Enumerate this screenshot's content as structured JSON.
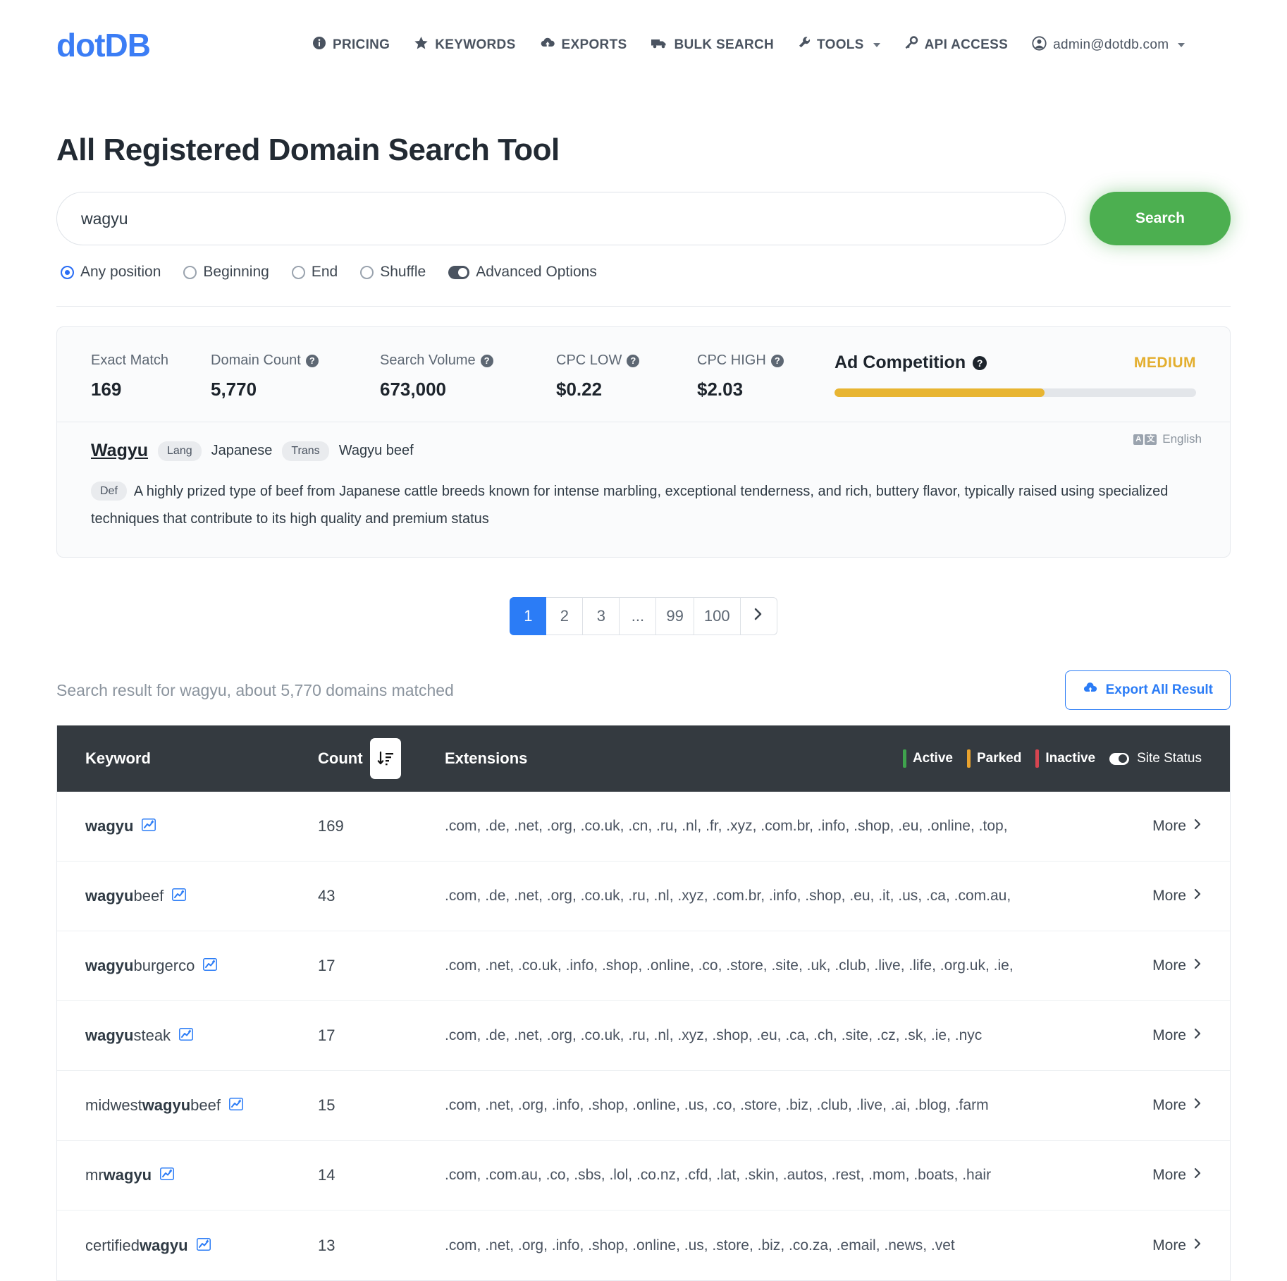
{
  "nav": {
    "brand": "dotDB",
    "links": [
      {
        "label": "PRICING",
        "icon": "info-icon"
      },
      {
        "label": "KEYWORDS",
        "icon": "star-icon"
      },
      {
        "label": "EXPORTS",
        "icon": "download-cloud-icon"
      },
      {
        "label": "BULK SEARCH",
        "icon": "truck-icon"
      },
      {
        "label": "TOOLS",
        "icon": "wrench-icon",
        "caret": true
      },
      {
        "label": "API ACCESS",
        "icon": "key-icon"
      },
      {
        "label": "admin@dotdb.com",
        "icon": "user-circle-icon",
        "caret": true
      }
    ]
  },
  "page": {
    "title": "All Registered Domain Search Tool"
  },
  "search": {
    "value": "wagyu",
    "placeholder": "",
    "button_label": "Search",
    "options": [
      {
        "label": "Any position",
        "selected": true
      },
      {
        "label": "Beginning",
        "selected": false
      },
      {
        "label": "End",
        "selected": false
      },
      {
        "label": "Shuffle",
        "selected": false
      }
    ],
    "advanced_label": "Advanced Options"
  },
  "stats": [
    {
      "label": "Exact Match",
      "value": "169",
      "help": false
    },
    {
      "label": "Domain Count",
      "value": "5,770",
      "help": true
    },
    {
      "label": "Search Volume",
      "value": "673,000",
      "help": true
    },
    {
      "label": "CPC LOW",
      "value": "$0.22",
      "help": true
    },
    {
      "label": "CPC HIGH",
      "value": "$2.03",
      "help": true
    }
  ],
  "ad_competition": {
    "title": "Ad Competition",
    "level": "MEDIUM",
    "percent": 58,
    "color": "#e8b532"
  },
  "definition": {
    "word": "Wagyu",
    "lang_tag": "Lang",
    "lang_value": "Japanese",
    "trans_tag": "Trans",
    "trans_value": "Wagyu beef",
    "def_tag": "Def",
    "def_text": "A highly prized type of beef from Japanese cattle breeds known for intense marbling, exceptional tenderness, and rich, buttery flavor, typically raised using specialized techniques that contribute to its high quality and premium status",
    "translate_language": "English"
  },
  "pagination": {
    "pages": [
      "1",
      "2",
      "3",
      "...",
      "99",
      "100"
    ],
    "active": "1",
    "next_label": "›"
  },
  "results": {
    "summary": "Search result for wagyu, about 5,770 domains matched",
    "export_label": "Export All Result",
    "columns": {
      "keyword": "Keyword",
      "count": "Count",
      "extensions": "Extensions",
      "more": "More"
    },
    "legend": [
      {
        "label": "Active",
        "color": "#3fa34d"
      },
      {
        "label": "Parked",
        "color": "#e8a22e"
      },
      {
        "label": "Inactive",
        "color": "#d64550"
      }
    ],
    "site_status_label": "Site Status",
    "rows": [
      {
        "prefix": "",
        "bold": "wagyu",
        "suffix": "",
        "count": "169",
        "extensions": [
          {
            "t": ".com",
            "s": "g"
          },
          {
            "t": ".de",
            "s": "g"
          },
          {
            "t": ".net",
            "s": "g"
          },
          {
            "t": ".org",
            "s": "g"
          },
          {
            "t": ".co.uk",
            "s": "g"
          },
          {
            "t": ".cn",
            "s": "r"
          },
          {
            "t": ".ru",
            "s": "g"
          },
          {
            "t": ".nl",
            "s": "g"
          },
          {
            "t": ".fr",
            "s": "g"
          },
          {
            "t": ".xyz",
            "s": "o"
          },
          {
            "t": ".com.br",
            "s": "g"
          },
          {
            "t": ".info",
            "s": "o"
          },
          {
            "t": ".shop",
            "s": "g"
          },
          {
            "t": ".eu",
            "s": "g"
          },
          {
            "t": ".online",
            "s": "o"
          },
          {
            "t": ".top",
            "s": "r"
          }
        ],
        "trailing_comma": true
      },
      {
        "prefix": "",
        "bold": "wagyu",
        "suffix": "beef",
        "count": "43",
        "extensions": [
          {
            "t": ".com",
            "s": "g"
          },
          {
            "t": ".de",
            "s": "o"
          },
          {
            "t": ".net",
            "s": "o"
          },
          {
            "t": ".org",
            "s": "o"
          },
          {
            "t": ".co.uk",
            "s": "g"
          },
          {
            "t": ".ru",
            "s": "g"
          },
          {
            "t": ".nl",
            "s": "g"
          },
          {
            "t": ".xyz",
            "s": "o"
          },
          {
            "t": ".com.br",
            "s": "g"
          },
          {
            "t": ".info",
            "s": "o"
          },
          {
            "t": ".shop",
            "s": "g"
          },
          {
            "t": ".eu",
            "s": "g"
          },
          {
            "t": ".it",
            "s": "g"
          },
          {
            "t": ".us",
            "s": "g"
          },
          {
            "t": ".ca",
            "s": "g"
          },
          {
            "t": ".com.au",
            "s": "g"
          }
        ],
        "trailing_comma": true
      },
      {
        "prefix": "",
        "bold": "wagyu",
        "suffix": "burgerco",
        "count": "17",
        "extensions": [
          {
            "t": ".com",
            "s": "g"
          },
          {
            "t": ".net",
            "s": "g"
          },
          {
            "t": ".co.uk",
            "s": "g"
          },
          {
            "t": ".info",
            "s": "g"
          },
          {
            "t": ".shop",
            "s": "g"
          },
          {
            "t": ".online",
            "s": "g"
          },
          {
            "t": ".co",
            "s": "g"
          },
          {
            "t": ".store",
            "s": "g"
          },
          {
            "t": ".site",
            "s": "g"
          },
          {
            "t": ".uk",
            "s": "g"
          },
          {
            "t": ".club",
            "s": "g"
          },
          {
            "t": ".live",
            "s": "g"
          },
          {
            "t": ".life",
            "s": "g"
          },
          {
            "t": ".org.uk",
            "s": "g"
          },
          {
            "t": ".ie",
            "s": "g"
          }
        ],
        "trailing_comma": true
      },
      {
        "prefix": "",
        "bold": "wagyu",
        "suffix": "steak",
        "count": "17",
        "extensions": [
          {
            "t": ".com",
            "s": "g"
          },
          {
            "t": ".de",
            "s": "g"
          },
          {
            "t": ".net",
            "s": "r"
          },
          {
            "t": ".org",
            "s": "g"
          },
          {
            "t": ".co.uk",
            "s": "g"
          },
          {
            "t": ".ru",
            "s": "g"
          },
          {
            "t": ".nl",
            "s": "r"
          },
          {
            "t": ".xyz",
            "s": "o"
          },
          {
            "t": ".shop",
            "s": "g"
          },
          {
            "t": ".eu",
            "s": "r"
          },
          {
            "t": ".ca",
            "s": "g"
          },
          {
            "t": ".ch",
            "s": "g"
          },
          {
            "t": ".site",
            "s": "r"
          },
          {
            "t": ".cz",
            "s": "g"
          },
          {
            "t": ".sk",
            "s": "g"
          },
          {
            "t": ".ie",
            "s": "g"
          },
          {
            "t": ".nyc",
            "s": "o"
          }
        ],
        "trailing_comma": false
      },
      {
        "prefix": "midwest",
        "bold": "wagyu",
        "suffix": "beef",
        "count": "15",
        "extensions": [
          {
            "t": ".com",
            "s": "g"
          },
          {
            "t": ".net",
            "s": "o"
          },
          {
            "t": ".org",
            "s": "o"
          },
          {
            "t": ".info",
            "s": "o"
          },
          {
            "t": ".shop",
            "s": "o"
          },
          {
            "t": ".online",
            "s": "o"
          },
          {
            "t": ".us",
            "s": "o"
          },
          {
            "t": ".co",
            "s": "o"
          },
          {
            "t": ".store",
            "s": "o"
          },
          {
            "t": ".biz",
            "s": "o"
          },
          {
            "t": ".club",
            "s": "o"
          },
          {
            "t": ".live",
            "s": "o"
          },
          {
            "t": ".ai",
            "s": "o"
          },
          {
            "t": ".blog",
            "s": "o"
          },
          {
            "t": ".farm",
            "s": "o"
          }
        ],
        "trailing_comma": false
      },
      {
        "prefix": "mr",
        "bold": "wagyu",
        "suffix": "",
        "count": "14",
        "extensions": [
          {
            "t": ".com",
            "s": "o"
          },
          {
            "t": ".com.au",
            "s": "r"
          },
          {
            "t": ".co",
            "s": "g"
          },
          {
            "t": ".sbs",
            "s": "g"
          },
          {
            "t": ".lol",
            "s": "g"
          },
          {
            "t": ".co.nz",
            "s": "g"
          },
          {
            "t": ".cfd",
            "s": "g"
          },
          {
            "t": ".lat",
            "s": "g"
          },
          {
            "t": ".skin",
            "s": "g"
          },
          {
            "t": ".autos",
            "s": "g"
          },
          {
            "t": ".rest",
            "s": "g"
          },
          {
            "t": ".mom",
            "s": "g"
          },
          {
            "t": ".boats",
            "s": "g"
          },
          {
            "t": ".hair",
            "s": "g"
          }
        ],
        "trailing_comma": false
      },
      {
        "prefix": "certified",
        "bold": "wagyu",
        "suffix": "",
        "count": "13",
        "extensions": [
          {
            "t": ".com",
            "s": "g"
          },
          {
            "t": ".net",
            "s": "g"
          },
          {
            "t": ".org",
            "s": "g"
          },
          {
            "t": ".info",
            "s": "g"
          },
          {
            "t": ".shop",
            "s": "g"
          },
          {
            "t": ".online",
            "s": "g"
          },
          {
            "t": ".us",
            "s": "g"
          },
          {
            "t": ".store",
            "s": "g"
          },
          {
            "t": ".biz",
            "s": "g"
          },
          {
            "t": ".co.za",
            "s": "g"
          },
          {
            "t": ".email",
            "s": "g"
          },
          {
            "t": ".news",
            "s": "g"
          },
          {
            "t": ".vet",
            "s": "g"
          }
        ],
        "trailing_comma": false
      }
    ]
  }
}
